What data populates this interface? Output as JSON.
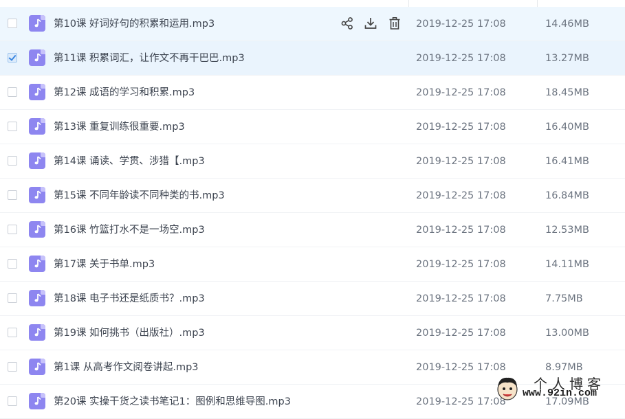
{
  "actions": {
    "share": "share-icon",
    "download": "download-icon",
    "delete": "delete-icon"
  },
  "files": [
    {
      "name": "第10课 好词好句的积累和运用.mp3",
      "date": "2019-12-25 17:08",
      "size": "14.46MB",
      "checked": false,
      "state": "hover"
    },
    {
      "name": "第11课 积累词汇，让作文不再干巴巴.mp3",
      "date": "2019-12-25 17:08",
      "size": "13.27MB",
      "checked": true,
      "state": "selected"
    },
    {
      "name": "第12课 成语的学习和积累.mp3",
      "date": "2019-12-25 17:08",
      "size": "18.45MB",
      "checked": false,
      "state": ""
    },
    {
      "name": "第13课 重复训练很重要.mp3",
      "date": "2019-12-25 17:08",
      "size": "16.40MB",
      "checked": false,
      "state": ""
    },
    {
      "name": "第14课 诵读、学贯、涉猎【.mp3",
      "date": "2019-12-25 17:08",
      "size": "16.41MB",
      "checked": false,
      "state": ""
    },
    {
      "name": "第15课 不同年龄读不同种类的书.mp3",
      "date": "2019-12-25 17:08",
      "size": "16.84MB",
      "checked": false,
      "state": ""
    },
    {
      "name": "第16课 竹篮打水不是一场空.mp3",
      "date": "2019-12-25 17:08",
      "size": "12.53MB",
      "checked": false,
      "state": ""
    },
    {
      "name": "第17课 关于书单.mp3",
      "date": "2019-12-25 17:08",
      "size": "14.11MB",
      "checked": false,
      "state": ""
    },
    {
      "name": "第18课 电子书还是纸质书？.mp3",
      "date": "2019-12-25 17:08",
      "size": "7.75MB",
      "checked": false,
      "state": ""
    },
    {
      "name": "第19课 如何挑书（出版社）.mp3",
      "date": "2019-12-25 17:08",
      "size": "13.00MB",
      "checked": false,
      "state": ""
    },
    {
      "name": "第1课 从高考作文阅卷讲起.mp3",
      "date": "2019-12-25 17:08",
      "size": "8.97MB",
      "checked": false,
      "state": ""
    },
    {
      "name": "第20课 实操干货之读书笔记1：图例和思维导图.mp3",
      "date": "2019-12-25 17:08",
      "size": "17.09MB",
      "checked": false,
      "state": ""
    }
  ],
  "watermark": {
    "title": "个人博客",
    "url": "www.92in.com"
  },
  "colors": {
    "hover": "#eef7fe",
    "selected": "#eaf4fd",
    "file_icon": "#8e86f0"
  }
}
